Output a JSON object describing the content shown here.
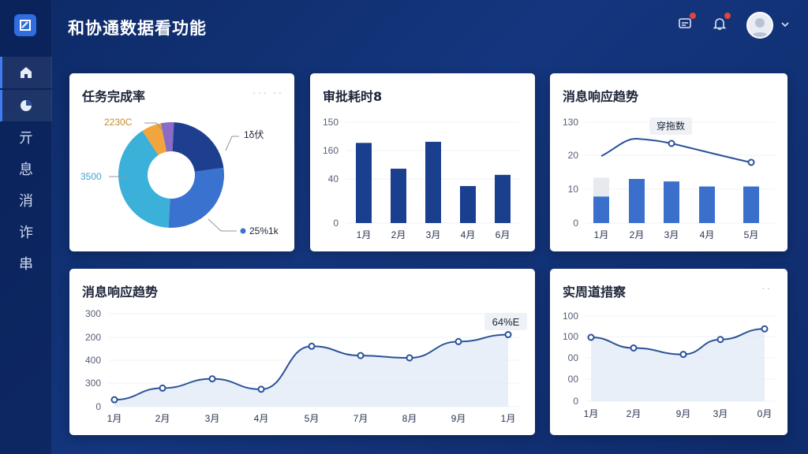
{
  "app": {
    "title": "和协通数据看功能"
  },
  "sidebar": {
    "items": [
      {
        "icon": "home-icon"
      },
      {
        "icon": "pie-chart-icon"
      },
      {
        "label": "亓"
      },
      {
        "label": "息"
      },
      {
        "label": "消"
      },
      {
        "label": "诈"
      },
      {
        "label": "串"
      }
    ]
  },
  "header": {
    "icons": [
      "message-icon",
      "bell-icon",
      "user-avatar",
      "chevron-down-icon"
    ]
  },
  "colors": {
    "primary": "#1f3f8c",
    "bar": "#1b3f8f",
    "bar_light": "#3a6fcc",
    "line": "#2a5298",
    "donut_orange": "#f2a53d",
    "donut_cyan": "#3bb0d9",
    "donut_purple": "#8a6bc6",
    "donut_blue": "#3a72d0",
    "donut_navy": "#1e3f8f"
  },
  "cards": {
    "donut": {
      "title": "任务完成率",
      "more": "··· ··",
      "chart_data": {
        "type": "pie",
        "values": [
          4,
          22,
          28,
          40,
          6
        ],
        "labels": {
          "top_left": "2230C",
          "left": "3500",
          "right_top": "1δ伏",
          "right_bottom": "25%1k"
        }
      }
    },
    "bar1": {
      "title": "审批耗时8",
      "chart_data": {
        "type": "bar",
        "categories": [
          "1月",
          "2月",
          "3月",
          "4月",
          "6月"
        ],
        "values": [
          143,
          97,
          145,
          66,
          86
        ],
        "ytick_labels": [
          "150",
          "160",
          "40",
          "0"
        ],
        "ylim": [
          0,
          180
        ]
      }
    },
    "combo": {
      "title": "消息响应趋势",
      "tooltip": "穿拖数",
      "chart_data": {
        "type": "bar",
        "categories": [
          "1月",
          "2月",
          "3月",
          "4月",
          "5月"
        ],
        "series": [
          {
            "values": [
              10.5,
              17.5,
              16.5,
              14.5,
              14.5
            ]
          },
          {
            "values": [
              26,
              31.2,
              29,
              0,
              24
            ]
          }
        ],
        "line_x": [
          "1月",
          "1.8月",
          "2.5月",
          "5月"
        ],
        "ytick_labels": [
          "130",
          "20",
          "10",
          "0"
        ],
        "ylim": [
          0,
          40
        ],
        "ghost_bar": [
          1,
          18
        ]
      }
    },
    "line1": {
      "title": "消息响应趋势",
      "badge": "64%E",
      "chart_data": {
        "type": "area",
        "categories": [
          "1月",
          "2月",
          "3月",
          "4月",
          "5月",
          "7月",
          "8月",
          "9月",
          "1月"
        ],
        "values": [
          30,
          80,
          120,
          75,
          260,
          220,
          210,
          280,
          310
        ],
        "ytick_labels": [
          "300",
          "200",
          "400",
          "300",
          "0"
        ],
        "ylim": [
          0,
          400
        ]
      }
    },
    "line2": {
      "title": "实周道措察",
      "more": "··",
      "chart_data": {
        "type": "area",
        "categories": [
          "1月",
          "2月",
          "9月",
          "3月",
          "0月"
        ],
        "values": [
          300,
          250,
          220,
          290,
          340
        ],
        "ytick_labels": [
          "100",
          "100",
          "00",
          "00",
          "0"
        ],
        "ylim": [
          0,
          400
        ]
      }
    }
  }
}
